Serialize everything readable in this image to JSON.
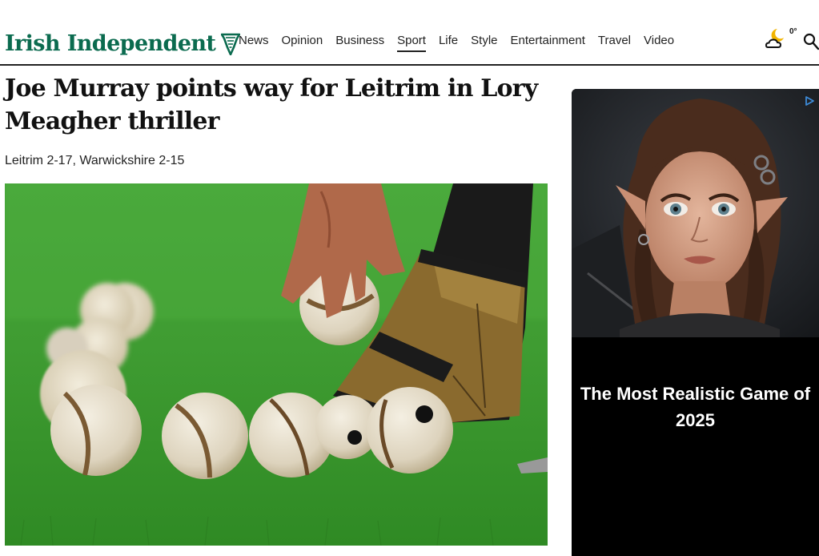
{
  "header": {
    "brand": "Irish Independent",
    "nav": [
      {
        "label": "News"
      },
      {
        "label": "Opinion"
      },
      {
        "label": "Business"
      },
      {
        "label": "Sport",
        "active": true
      },
      {
        "label": "Life"
      },
      {
        "label": "Style"
      },
      {
        "label": "Entertainment"
      },
      {
        "label": "Travel"
      },
      {
        "label": "Video"
      }
    ],
    "weather": {
      "temp": "0°",
      "icon": "weather-partly-cloudy-night-icon"
    },
    "search_icon": "search-icon"
  },
  "article": {
    "headline": "Joe Murray points way for Leitrim in Lory Meagher thriller",
    "standfirst": "Leitrim 2-17, Warwickshire 2-15",
    "image": {
      "subject": "hurling sliotars on grass, hurley and hand"
    }
  },
  "ad": {
    "headline": "The Most Realistic Game of 2025",
    "badge_icon": "ad-choices-icon"
  },
  "colors": {
    "brand_green": "#0b6b4f",
    "text": "#111111",
    "ad_bg": "#000000"
  }
}
